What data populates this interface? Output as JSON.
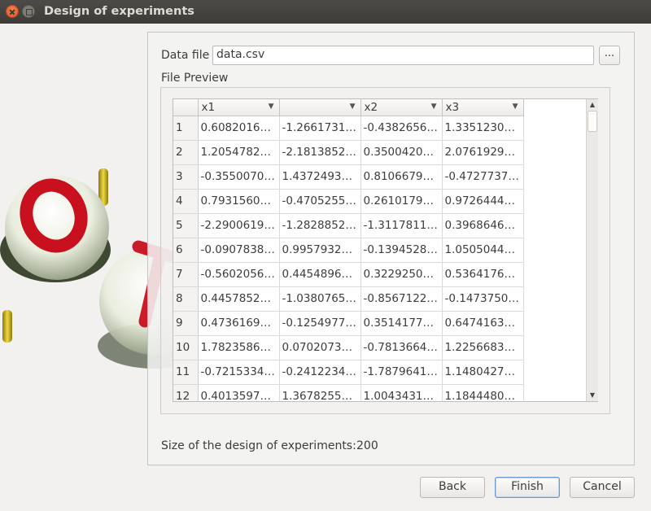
{
  "window": {
    "title": "Design of experiments"
  },
  "form": {
    "data_file_label": "Data file",
    "data_file_value": "data.csv",
    "browse_label": "...",
    "preview_label": "File Preview",
    "size_label": "Size of the design of experiments:",
    "size_value": "200"
  },
  "table": {
    "columns": [
      "x1",
      "",
      "x2",
      "x3"
    ],
    "rows": [
      {
        "index": "1",
        "cells": [
          "0.6082016…",
          "-1.2661731…",
          "-0.4382656…",
          "1.3351230…"
        ]
      },
      {
        "index": "2",
        "cells": [
          "1.2054782…",
          "-2.1813852…",
          "0.3500420…",
          "2.0761929…"
        ]
      },
      {
        "index": "3",
        "cells": [
          "-0.3550070…",
          "1.4372493…",
          "0.8106679…",
          "-0.4727737…"
        ]
      },
      {
        "index": "4",
        "cells": [
          "0.7931560…",
          "-0.4705255…",
          "0.2610179…",
          "0.9726444…"
        ]
      },
      {
        "index": "5",
        "cells": [
          "-2.2900619…",
          "-1.2828852…",
          "-1.3117811…",
          "0.3968646…"
        ]
      },
      {
        "index": "6",
        "cells": [
          "-0.0907838…",
          "0.9957932…",
          "-0.1394528…",
          "1.0505044…"
        ]
      },
      {
        "index": "7",
        "cells": [
          "-0.5602056…",
          "0.4454896…",
          "0.3229250…",
          "0.5364176…"
        ]
      },
      {
        "index": "8",
        "cells": [
          "0.4457852…",
          "-1.0380765…",
          "-0.8567122…",
          "-0.1473750…"
        ]
      },
      {
        "index": "9",
        "cells": [
          "0.4736169…",
          "-0.1254977…",
          "0.3514177…",
          "0.6474163…"
        ]
      },
      {
        "index": "10",
        "cells": [
          "1.7823586…",
          "0.0702073…",
          "-0.7813664…",
          "1.2256683…"
        ]
      },
      {
        "index": "11",
        "cells": [
          "-0.7215334…",
          "-0.2412234…",
          "-1.7879641…",
          "1.1480427…"
        ]
      },
      {
        "index": "12",
        "cells": [
          "0.4013597…",
          "1.3678255…",
          "1.0043431…",
          "1.1844480…"
        ]
      }
    ]
  },
  "buttons": {
    "back": "Back",
    "finish": "Finish",
    "cancel": "Cancel"
  },
  "icons": {
    "close": "close-icon",
    "maximize": "maximize-icon",
    "sort": "chevron-down-icon",
    "scroll_up": "scroll-up-icon",
    "scroll_down": "scroll-down-icon"
  },
  "colors": {
    "titlebar": "#3c3b37",
    "close": "#e0561f",
    "logo_red": "#c8101e",
    "logo_gold": "#c8b020"
  }
}
